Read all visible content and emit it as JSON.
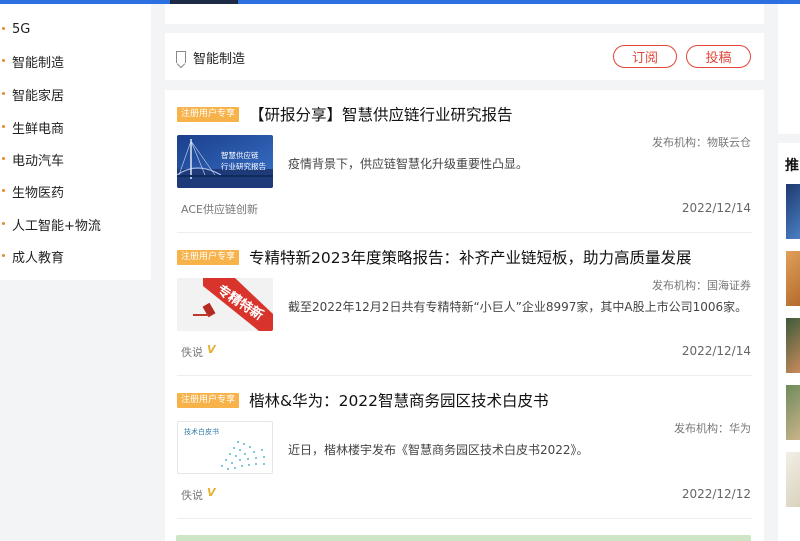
{
  "sidebar": {
    "items": [
      {
        "label": "5G"
      },
      {
        "label": "智能制造"
      },
      {
        "label": "智能家居"
      },
      {
        "label": "生鲜电商"
      },
      {
        "label": "电动汽车"
      },
      {
        "label": "生物医药"
      },
      {
        "label": "人工智能+物流"
      },
      {
        "label": "成人教育"
      }
    ]
  },
  "channel": {
    "name": "智能制造",
    "subscribe_label": "订阅",
    "submit_label": "投稿"
  },
  "articles": [
    {
      "tag": "注册用户专享",
      "title": "【研报分享】智慧供应链行业研究报告",
      "source": "发布机构：物联云仓",
      "summary": "疫情背景下，供应链智慧化升级重要性凸显。",
      "author": "ACE供应链创新",
      "date": "2022/12/14",
      "thumb_text_1": "智慧供应链",
      "thumb_text_2": "行业研究报告"
    },
    {
      "tag": "注册用户专享",
      "title": "专精特新2023年度策略报告：补齐产业链短板，助力高质量发展",
      "source": "发布机构：国海证券",
      "summary": "截至2022年12月2日共有专精特新“小巨人”企业8997家，其中A股上市公司1006家。",
      "author": "佚说",
      "verified": "V",
      "date": "2022/12/14",
      "thumb_text": "专精特新"
    },
    {
      "tag": "注册用户专享",
      "title": "楷林&华为：2022智慧商务园区技术白皮书",
      "source": "发布机构：华为",
      "summary": "近日，楷林楼宇发布《智慧商务园区技术白皮书2022》。",
      "author": "佚说",
      "verified": "V",
      "date": "2022/12/12",
      "thumb_text": "技术白皮书"
    }
  ],
  "right_panel": {
    "heading": "推"
  },
  "colors": {
    "accent_blue": "#2c6fe0",
    "tag_orange": "#f7b24a",
    "button_red": "#e0463a"
  }
}
